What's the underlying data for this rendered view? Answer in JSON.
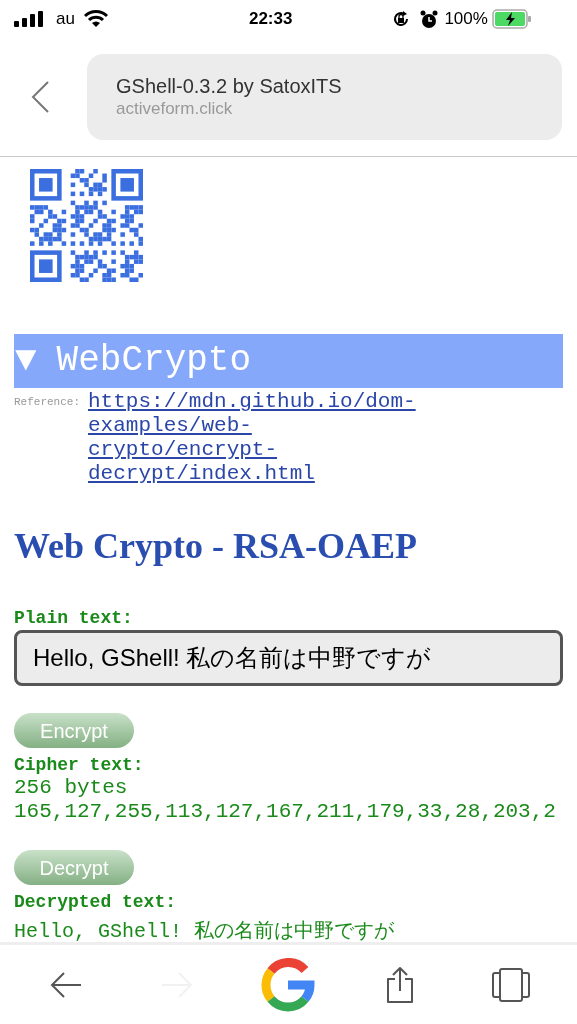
{
  "status_bar": {
    "carrier": "au",
    "time": "22:33",
    "battery": "100%"
  },
  "address_bar": {
    "title": "GShell-0.3.2 by SatoxITS",
    "domain": "activeform.click"
  },
  "section": {
    "toggle": "▼",
    "title": "WebCrypto",
    "expanded": true,
    "reference_label": "Reference:",
    "reference_link": "https://mdn.github.io/dom-examples/web-crypto/encrypt-decrypt/index.html"
  },
  "heading": "Web Crypto - RSA-OAEP",
  "plain_text": {
    "label": "Plain text:",
    "value": "Hello, GShell! 私の名前は中野ですが"
  },
  "encrypt_button": "Encrypt",
  "cipher_text": {
    "label": "Cipher text:",
    "size": "256 bytes",
    "bytes": "165,127,255,113,127,167,211,179,33,28,203,2"
  },
  "decrypt_button": "Decrypt",
  "decrypted_text": {
    "label": "Decrypted text:",
    "value": "Hello, GShell! 私の名前は中野ですが"
  },
  "toolbar": [
    {
      "kind": "back",
      "disabled": false
    },
    {
      "kind": "forward",
      "disabled": true
    },
    {
      "kind": "google",
      "disabled": false
    },
    {
      "kind": "share",
      "disabled": false
    },
    {
      "kind": "tabs",
      "disabled": false
    }
  ]
}
